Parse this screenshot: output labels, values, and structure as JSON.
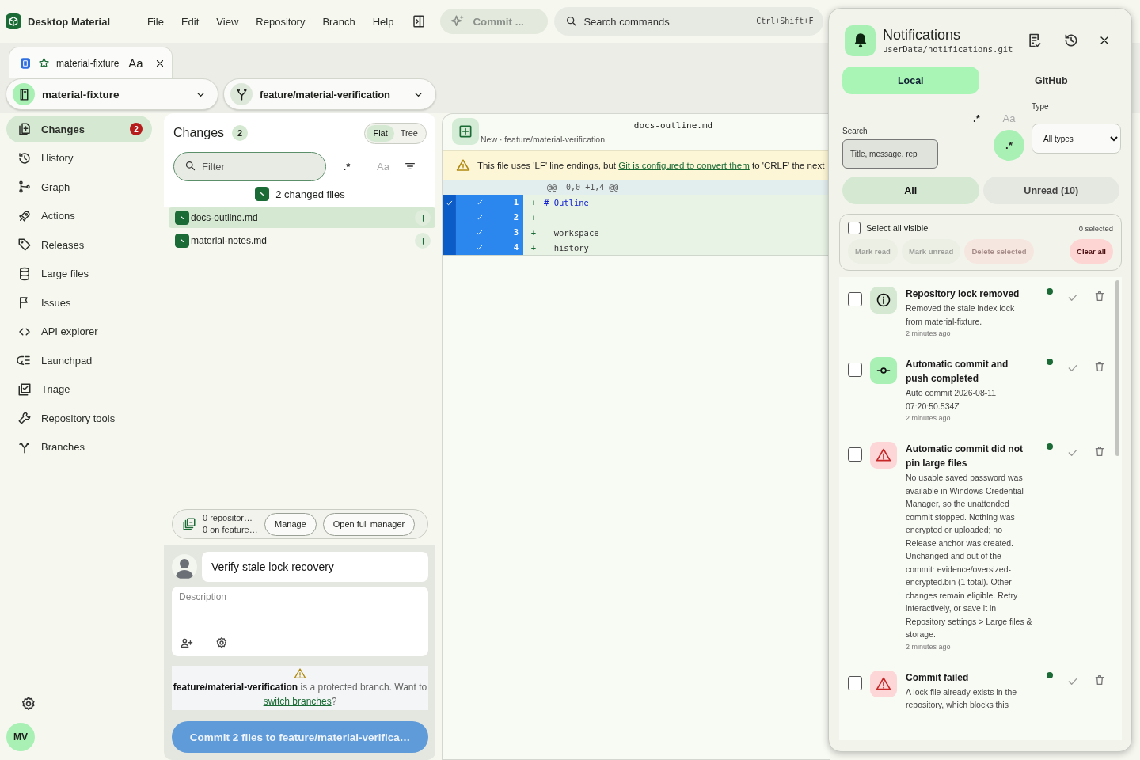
{
  "app": {
    "title": "Desktop Material"
  },
  "menu": [
    "File",
    "Edit",
    "View",
    "Repository",
    "Branch",
    "Help"
  ],
  "commit_shortcut": {
    "label": "Commit ...",
    "disabled": true
  },
  "command_search": {
    "placeholder": "Search commands",
    "shortcut": "Ctrl+Shift+F"
  },
  "repo_tabs": [
    {
      "label": "material-fixture",
      "case_label": "Aa",
      "selected": true
    }
  ],
  "repository": {
    "name": "material-fixture"
  },
  "branch": {
    "name": "feature/material-verification"
  },
  "sidebar": {
    "items": [
      {
        "label": "Changes",
        "badge": "2",
        "selected": true
      },
      {
        "label": "History",
        "selected": false
      },
      {
        "label": "Graph",
        "selected": false
      },
      {
        "label": "Actions",
        "selected": false
      },
      {
        "label": "Releases",
        "selected": false
      },
      {
        "label": "Large files",
        "selected": false
      },
      {
        "label": "Issues",
        "selected": false
      },
      {
        "label": "API explorer",
        "selected": false
      },
      {
        "label": "Launchpad",
        "selected": false
      },
      {
        "label": "Triage",
        "selected": false
      },
      {
        "label": "Repository tools",
        "selected": false
      },
      {
        "label": "Branches",
        "selected": false
      }
    ]
  },
  "user": {
    "initials": "MV"
  },
  "changes": {
    "title": "Changes",
    "count": "2",
    "view_modes": [
      {
        "label": "Flat",
        "selected": true
      },
      {
        "label": "Tree",
        "selected": false
      }
    ],
    "filter": {
      "placeholder": "Filter"
    },
    "toggles": [
      {
        "label": ".*",
        "on": false
      },
      {
        "label": "Aa",
        "on": false
      }
    ],
    "summary": {
      "label": "2 changed files",
      "checked": true
    },
    "files": [
      {
        "name": "docs-outline.md",
        "checked": true,
        "selected": true
      },
      {
        "name": "material-notes.md",
        "checked": true,
        "selected": false
      }
    ]
  },
  "large_files": {
    "line_1": "0 repositor…",
    "line_2": "0 on feature…",
    "buttons": [
      "Manage",
      "Open full manager"
    ]
  },
  "commit": {
    "summary": "Verify stale lock recovery",
    "description_placeholder": "Description",
    "warning": {
      "message": "**feature/material-verification** is a protected branch. Want to",
      "link": "switch branches",
      "after": "?"
    },
    "button": {
      "label": "Commit 2 files to feature/material-verifica…",
      "disabled": true
    }
  },
  "diff": {
    "file": "docs-outline.md",
    "subtitle": "New · feature/material-verification",
    "warning": {
      "before": "This file uses 'LF' line endings, but ",
      "link": "Git is configured to convert them",
      "after": " to 'CRLF' the next"
    },
    "hunk": "@@ -0,0 +1,4 @@",
    "hunk_selected": true,
    "lines": [
      {
        "number": "1",
        "prefix": "+",
        "text": "# Outline",
        "kind": "heading",
        "selected": true
      },
      {
        "number": "2",
        "prefix": "+",
        "selected": true
      },
      {
        "number": "3",
        "prefix": "+",
        "text": "- workspace",
        "kind": "text",
        "selected": true
      },
      {
        "number": "4",
        "prefix": "+",
        "text": "- history",
        "kind": "text",
        "selected": true
      }
    ]
  },
  "notifications": {
    "title": "Notifications",
    "path": "userData/notifications.git",
    "sources": [
      {
        "label": "Local",
        "selected": true
      },
      {
        "label": "GitHub",
        "selected": false
      }
    ],
    "search": {
      "label": "Search",
      "placeholder": "Title, message, rep"
    },
    "toggles": [
      {
        "label": ".*",
        "on": false
      },
      {
        "label": "Aa",
        "on": false
      },
      {
        "label": ".*",
        "on": true
      }
    ],
    "type": {
      "label": "Type",
      "value": "All types"
    },
    "filters": [
      {
        "label": "All",
        "selected": true
      },
      {
        "label": "Unread (10)",
        "selected": false
      }
    ],
    "select_all": {
      "label": "Select all visible",
      "checked": false,
      "count": "0 selected"
    },
    "actions": [
      {
        "label": "Mark read",
        "kind": "neutral",
        "disabled": true
      },
      {
        "label": "Mark unread",
        "kind": "neutral",
        "disabled": true
      },
      {
        "label": "Delete selected",
        "kind": "danger",
        "disabled": true
      },
      {
        "label": "Clear all",
        "kind": "danger",
        "disabled": false
      }
    ],
    "items": [
      {
        "kind": "info",
        "title": "Repository lock removed",
        "message": "Removed the stale index lock from material-fixture.",
        "time": "2 minutes ago",
        "unread": true,
        "checked": false
      },
      {
        "kind": "commit",
        "title": "Automatic commit and push completed",
        "message": "Auto commit 2026-08-11 07:20:50.534Z",
        "time": "2 minutes ago",
        "unread": true,
        "checked": false
      },
      {
        "kind": "warning",
        "title": "Automatic commit did not pin large files",
        "message": "No usable saved password was available in Windows Credential Manager, so the unattended commit stopped. Nothing was encrypted or uploaded; no Release anchor was created. Unchanged and out of the commit: evidence/oversized-encrypted.bin (1 total). Other changes remain eligible. Retry interactively, or save it in Repository settings > Large files & storage.",
        "time": "2 minutes ago",
        "unread": true,
        "checked": false
      },
      {
        "kind": "warning",
        "title": "Commit failed",
        "message": "A lock file already exists in the repository, which blocks this",
        "unread": true,
        "checked": false
      }
    ]
  }
}
